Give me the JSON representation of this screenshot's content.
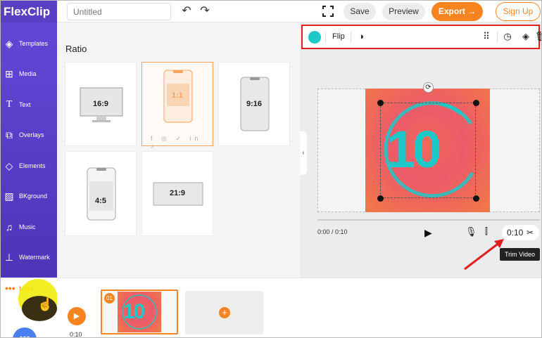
{
  "app": {
    "logo_text": "FlexClip",
    "brand_color": "#5a3fc4",
    "accent_color": "#f7841f"
  },
  "header": {
    "title_placeholder": "Untitled",
    "undo_icon": "undo-icon",
    "redo_icon": "redo-icon",
    "fit_icon": "fullscreen-icon",
    "save_label": "Save",
    "preview_label": "Preview",
    "export_label": "Export →",
    "signup_label": "Sign Up"
  },
  "sidebar": {
    "items": [
      {
        "label": "Templates",
        "icon": "templates-icon"
      },
      {
        "label": "Media",
        "icon": "media-icon"
      },
      {
        "label": "Text",
        "icon": "text-icon"
      },
      {
        "label": "Overlays",
        "icon": "overlays-icon"
      },
      {
        "label": "Elements",
        "icon": "elements-icon"
      },
      {
        "label": "BKground",
        "icon": "background-icon"
      },
      {
        "label": "Music",
        "icon": "music-icon"
      },
      {
        "label": "Watermark",
        "icon": "watermark-icon"
      }
    ],
    "more_label": "More"
  },
  "ratio_panel": {
    "title": "Ratio",
    "options": [
      {
        "label": "16:9"
      },
      {
        "label": "1:1",
        "selected": true
      },
      {
        "label": "9:16"
      },
      {
        "label": "4:5"
      },
      {
        "label": "21:9"
      }
    ]
  },
  "toolbar": {
    "swatch_color": "#1ec8c8",
    "flip_label": "Flip"
  },
  "preview": {
    "overlay_text": "10",
    "time_display": "0:00 / 0:10",
    "duration_label": "0:10",
    "tooltip": "Trim Video",
    "overlay_color": "#1ec8c8"
  },
  "timeline": {
    "play_time": "0:10",
    "clips": [
      {
        "number": "01",
        "overlay_text": "10"
      }
    ]
  }
}
